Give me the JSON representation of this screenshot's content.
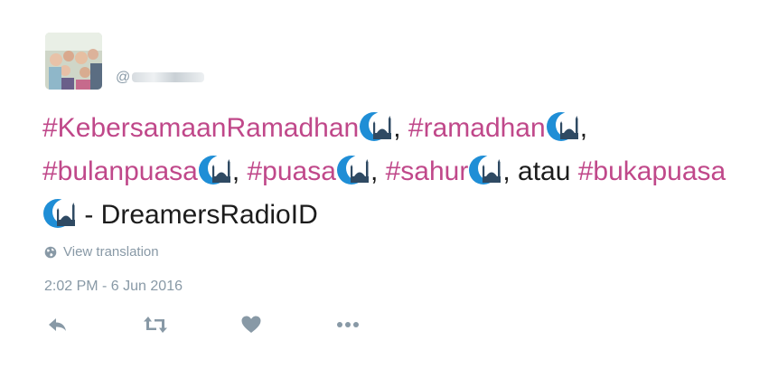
{
  "author": {
    "handle_prefix": "@"
  },
  "tweet": {
    "segments": [
      {
        "type": "hashtag",
        "text": "#KebersamaanRamadhan"
      },
      {
        "type": "emoji",
        "icon": "crescent-mosque-emoji"
      },
      {
        "type": "text",
        "text": ", "
      },
      {
        "type": "hashtag",
        "text": "#ramadhan"
      },
      {
        "type": "emoji",
        "icon": "crescent-mosque-emoji"
      },
      {
        "type": "text",
        "text": ", "
      },
      {
        "type": "hashtag",
        "text": "#bulanpuasa"
      },
      {
        "type": "emoji",
        "icon": "crescent-mosque-emoji"
      },
      {
        "type": "text",
        "text": ", "
      },
      {
        "type": "hashtag",
        "text": "#puasa"
      },
      {
        "type": "emoji",
        "icon": "crescent-mosque-emoji"
      },
      {
        "type": "text",
        "text": ", "
      },
      {
        "type": "hashtag",
        "text": "#sahur"
      },
      {
        "type": "emoji",
        "icon": "crescent-mosque-emoji"
      },
      {
        "type": "text",
        "text": ", atau "
      },
      {
        "type": "hashtag",
        "text": "#bukapuasa"
      },
      {
        "type": "emoji",
        "icon": "crescent-mosque-emoji"
      },
      {
        "type": "text",
        "text": " - DreamersRadioID"
      }
    ]
  },
  "translate_label": "View translation",
  "timestamp": "2:02 PM - 6 Jun 2016",
  "actions": [
    "reply-icon",
    "retweet-icon",
    "like-icon",
    "more-icon"
  ],
  "colors": {
    "hashtag": "#c0488a",
    "meta": "#8899a6",
    "crescent": "#1f8ed6",
    "mosque": "#2f4a63"
  }
}
